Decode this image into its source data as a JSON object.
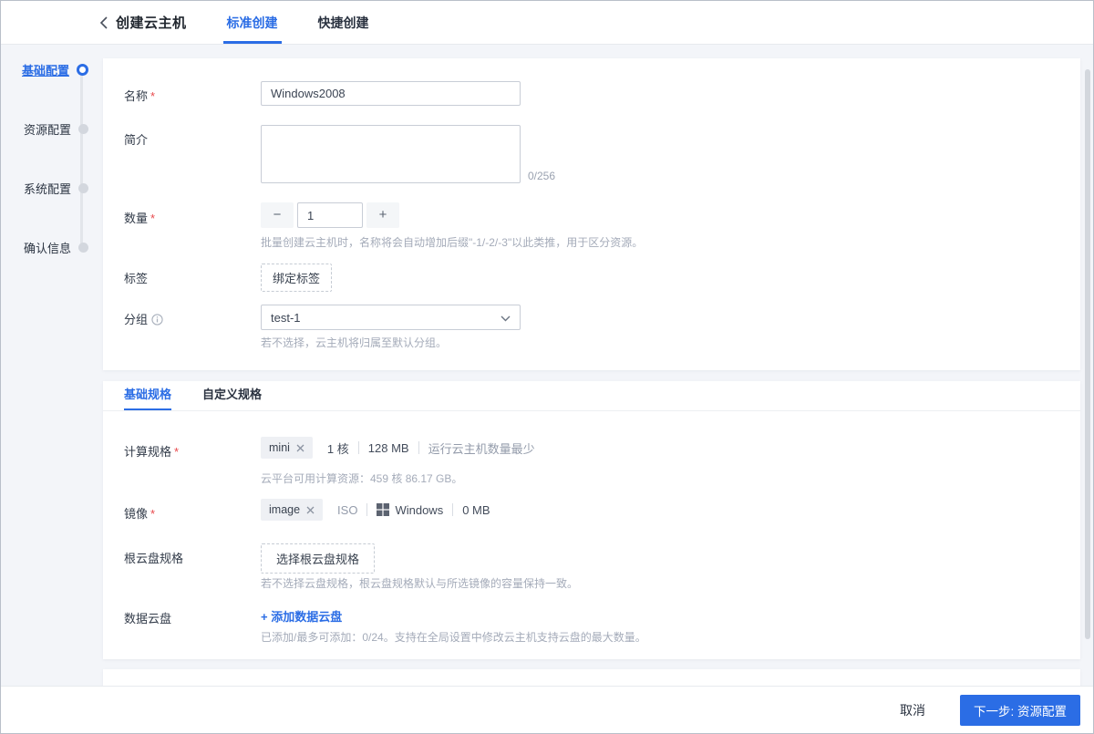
{
  "header": {
    "title": "创建云主机",
    "tabs": [
      {
        "label": "标准创建"
      },
      {
        "label": "快捷创建"
      }
    ]
  },
  "steps": [
    {
      "label": "基础配置"
    },
    {
      "label": "资源配置"
    },
    {
      "label": "系统配置"
    },
    {
      "label": "确认信息"
    }
  ],
  "ui": {
    "required_mark": "*"
  },
  "basic_form": {
    "name": {
      "label": "名称",
      "value": "Windows2008"
    },
    "intro": {
      "label": "简介",
      "value": "",
      "counter": "0/256"
    },
    "quantity": {
      "label": "数量",
      "value": "1",
      "minus_label": "−",
      "plus_label": "+",
      "hint": "批量创建云主机时，名称将会自动增加后缀\"-1/-2/-3\"以此类推，用于区分资源。"
    },
    "tag": {
      "label": "标签",
      "button_label": "绑定标签"
    },
    "group": {
      "label": "分组",
      "value": "test-1",
      "hint": "若不选择，云主机将归属至默认分组。"
    }
  },
  "spec_section": {
    "tabs": [
      {
        "label": "基础规格"
      },
      {
        "label": "自定义规格"
      }
    ],
    "compute": {
      "label": "计算规格",
      "tag": "mini",
      "details": [
        "1 核",
        "128 MB",
        "运行云主机数量最少"
      ],
      "hint": "云平台可用计算资源：459 核 86.17 GB。"
    },
    "image": {
      "label": "镜像",
      "tag": "image",
      "format": "ISO",
      "os": "Windows",
      "size": "0 MB"
    },
    "root_disk": {
      "label": "根云盘规格",
      "button_label": "选择根云盘规格",
      "hint": "若不选择云盘规格，根云盘规格默认与所选镜像的容量保持一致。"
    },
    "data_disk": {
      "label": "数据云盘",
      "link_label": "+ 添加数据云盘",
      "hint": "已添加/最多可添加：0/24。支持在全局设置中修改云主机支持云盘的最大数量。"
    }
  },
  "footer": {
    "cancel_label": "取消",
    "next_label": "下一步: 资源配置"
  },
  "colors": {
    "accent": "#2b6de5",
    "required": "#e8494c",
    "hint_text": "#a4abb9",
    "content_bg": "#f3f5f9"
  }
}
